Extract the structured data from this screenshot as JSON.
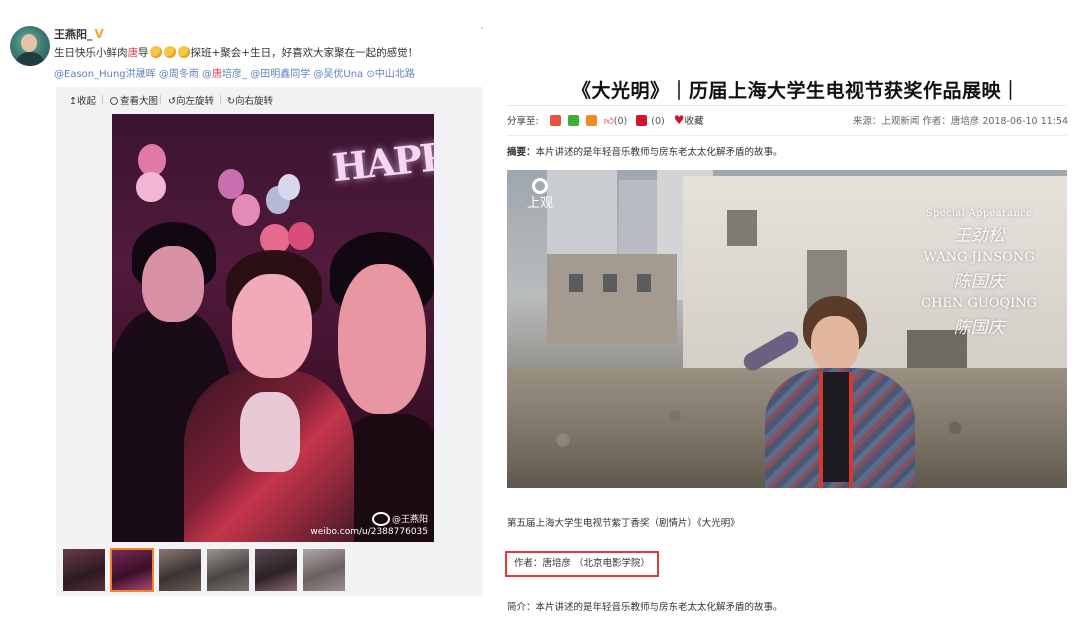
{
  "weibo": {
    "username": "王燕阳_",
    "vip_mark": "V",
    "post_text_before": "生日快乐小鲜肉",
    "post_text_hl": "唐",
    "post_text_mid": "导",
    "post_text_after": "探班+聚会+生日，好喜欢大家聚在一起的感觉！",
    "mentions_a": "@Eason_Hung洪晟晖 @周冬雨 @",
    "mentions_hl": "唐",
    "mentions_b": "培彦_ @田明鑫同学 @吴优Una",
    "location": "中山北路",
    "corner_mark": "`",
    "toolbar": {
      "collect": "收起",
      "view_large": "查看大图",
      "rotate_left": "向左旋转",
      "rotate_right": "向右旋转"
    },
    "photo": {
      "balloon_text": "HAPPY",
      "watermark_name": "@王燕阳",
      "watermark_url": "weibo.com/u/2388776035"
    },
    "thumb_count": 6,
    "active_thumb": 1
  },
  "article": {
    "title": "《大光明》｜历届上海大学生电视节获奖作品展映｜",
    "share_label": "分享至:",
    "like_count": "(0)",
    "comment_count": "(0)",
    "favorite_label": "收藏",
    "source": "来源：上观新闻  作者：唐培彦  2018-06-10 11:54",
    "summary_label": "摘要：",
    "summary_text": "本片讲述的是年轻音乐教师与房东老太太化解矛盾的故事。",
    "still": {
      "logo_text": "上观",
      "special": "Special Appearance",
      "sig1": "王劲松",
      "name1": "WANG JINSONG",
      "sig2": "陈国庆",
      "name2": "CHEN GUOQING",
      "sig3": "陈国庆"
    },
    "caption": "第五届上海大学生电视节紫丁香奖（剧情片）《大光明》",
    "author_line": "作者：唐培彦 （北京电影学院）",
    "intro": "简介：本片讲述的是年轻音乐教师与房东老太太化解矛盾的故事。",
    "colors": {
      "highlight_box": "#e03a3a",
      "link": "#5d7fc1",
      "heart": "#d4142a"
    }
  }
}
